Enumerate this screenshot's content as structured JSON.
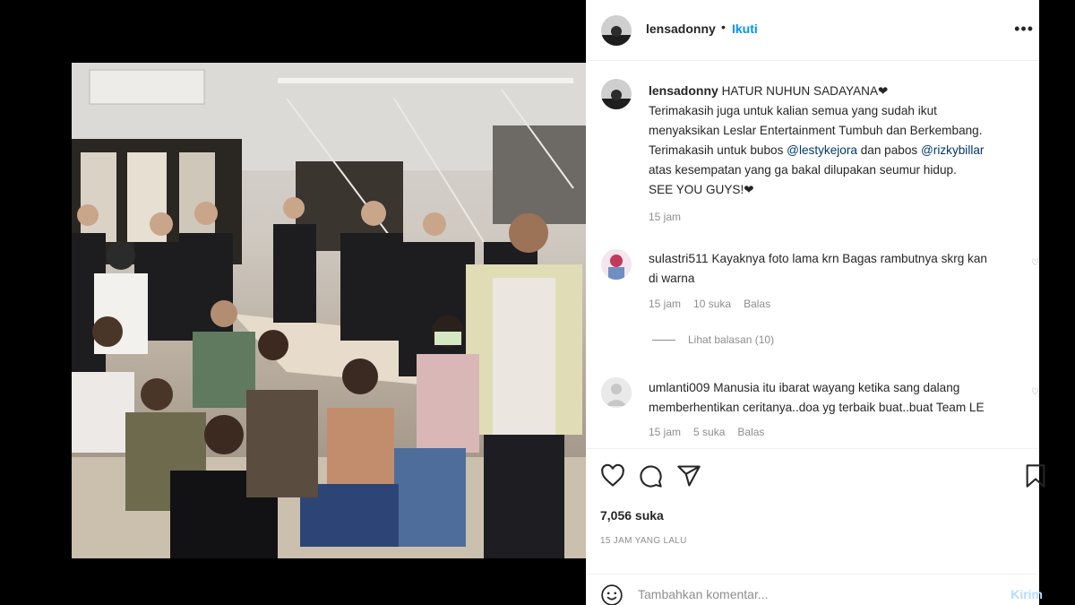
{
  "post": {
    "username": "lensadonny",
    "follow_label": "Ikuti",
    "more_label": "•••",
    "caption_title": "HATUR NUHUN SADAYANA",
    "caption_line1": "Terimakasih juga untuk kalian semua yang sudah ikut",
    "caption_line2": "menyaksikan Leslar Entertainment Tumbuh dan Berkembang.",
    "caption_line3_pre": "Terimakasih untuk bubos",
    "mention1": "@lestykejora",
    "caption_line3_mid": "dan pabos",
    "mention2": "@rizkybillar",
    "caption_line4": "atas kesempatan yang ga bakal dilupakan seumur hidup.",
    "caption_line5": "SEE YOU GUYS!",
    "caption_time": "15 jam"
  },
  "comments": [
    {
      "username": "sulastri511",
      "text_line1": "Kayaknya foto lama krn Bagas rambutnya skrg kan",
      "text_line2": "di warna",
      "time": "15 jam",
      "likes": "10 suka",
      "reply": "Balas",
      "view_replies": "Lihat balasan (10)"
    },
    {
      "username": "umlanti009",
      "text_line1": "Manusia itu ibarat wayang ketika sang dalang",
      "text_line2": "memberhentikan ceritanya..doa yg terbaik buat..buat Team LE",
      "time": "15 jam",
      "likes": "5 suka",
      "reply": "Balas"
    }
  ],
  "actions": {
    "likes_count": "7,056 suka",
    "time_ago": "15 JAM YANG LALU"
  },
  "add_comment": {
    "placeholder": "Tambahkan komentar...",
    "post_label": "Kirim"
  },
  "colors": {
    "link": "#0095f6",
    "mention": "#00376b",
    "muted": "#8e8e8e"
  },
  "icons": [
    "heart-icon",
    "comment-icon",
    "share-icon",
    "bookmark-icon",
    "emoji-icon",
    "more-icon"
  ]
}
